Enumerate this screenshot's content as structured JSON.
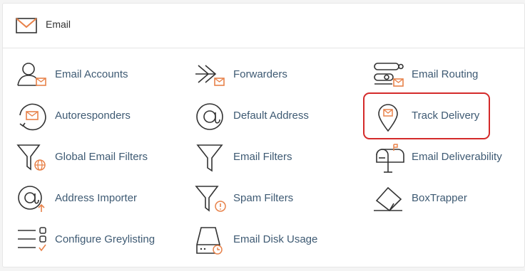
{
  "header": {
    "title": "Email",
    "icon": "envelope-icon"
  },
  "items": [
    {
      "label": "Email Accounts",
      "icon": "email-accounts-icon"
    },
    {
      "label": "Forwarders",
      "icon": "forwarders-icon"
    },
    {
      "label": "Email Routing",
      "icon": "email-routing-icon"
    },
    {
      "label": "Autoresponders",
      "icon": "autoresponders-icon"
    },
    {
      "label": "Default Address",
      "icon": "at-sign-icon"
    },
    {
      "label": "Track Delivery",
      "icon": "location-pin-icon",
      "highlighted": true
    },
    {
      "label": "Global Email Filters",
      "icon": "global-filter-icon"
    },
    {
      "label": "Email Filters",
      "icon": "filter-icon"
    },
    {
      "label": "Email Deliverability",
      "icon": "mailbox-icon"
    },
    {
      "label": "Address Importer",
      "icon": "address-importer-icon"
    },
    {
      "label": "Spam Filters",
      "icon": "spam-filter-icon"
    },
    {
      "label": "BoxTrapper",
      "icon": "boxtrapper-icon"
    },
    {
      "label": "Configure Greylisting",
      "icon": "greylisting-icon"
    },
    {
      "label": "Email Disk Usage",
      "icon": "disk-usage-icon"
    }
  ],
  "colors": {
    "accent": "#e8824a",
    "highlight_border": "#d42a2a",
    "link_text": "#3e5a73",
    "icon_stroke": "#333333"
  }
}
